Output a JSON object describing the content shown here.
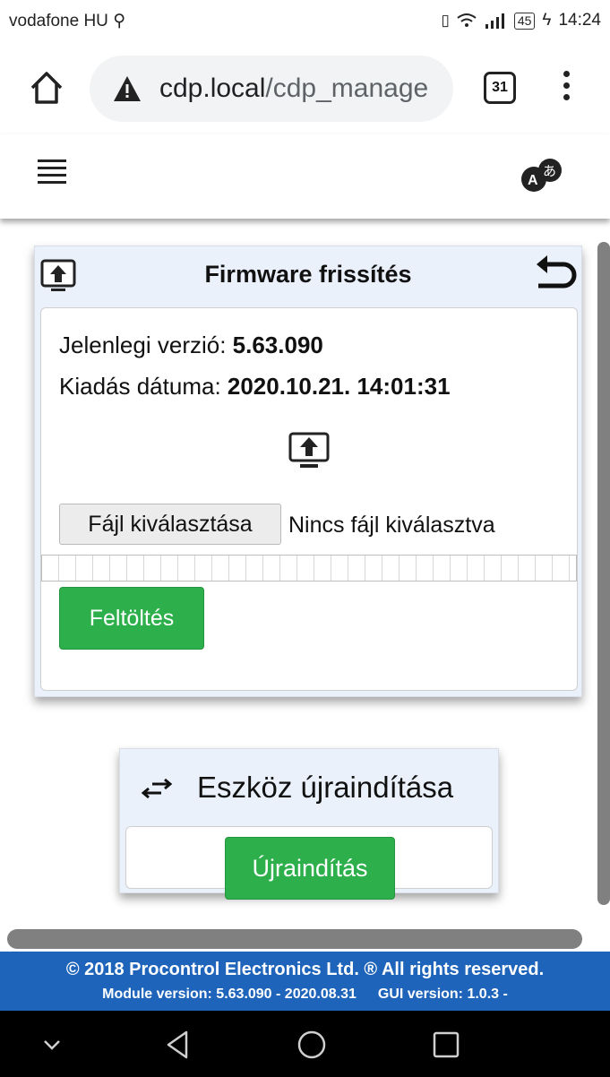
{
  "status_bar": {
    "carrier": "vodafone HU",
    "battery": "45",
    "time": "14:24"
  },
  "browser": {
    "url_host": "cdp.local",
    "url_path": "/cdp_manage",
    "tab_count": "31"
  },
  "firmware_card": {
    "title": "Firmware frissítés",
    "current_version_label": "Jelenlegi verzió: ",
    "current_version_value": "5.63.090",
    "release_date_label": "Kiadás dátuma: ",
    "release_date_value": "2020.10.21. 14:01:31",
    "file_button_label": "Fájl kiválasztása",
    "file_status": "Nincs fájl kiválasztva",
    "upload_progress": 0,
    "upload_button_label": "Feltöltés"
  },
  "restart_card": {
    "title": "Eszköz újraindítása",
    "restart_button_label": "Újraindítás"
  },
  "footer": {
    "copyright": "© 2018 Procontrol Electronics Ltd. ® All rights reserved.",
    "module_version": "Module version: 5.63.090 - 2020.08.31",
    "gui_version": "GUI version: 1.0.3 -"
  },
  "icons": {
    "home": "home-icon",
    "warning": "warning-icon",
    "menu": "hamburger-icon",
    "language": "translate-icon",
    "firmware": "firmware-upload-icon",
    "back": "back-arrow-icon",
    "restart": "swap-arrows-icon"
  },
  "colors": {
    "accent_green": "#2db04b",
    "footer_blue": "#1e64ba",
    "card_header_bg": "#eaf1fb"
  }
}
